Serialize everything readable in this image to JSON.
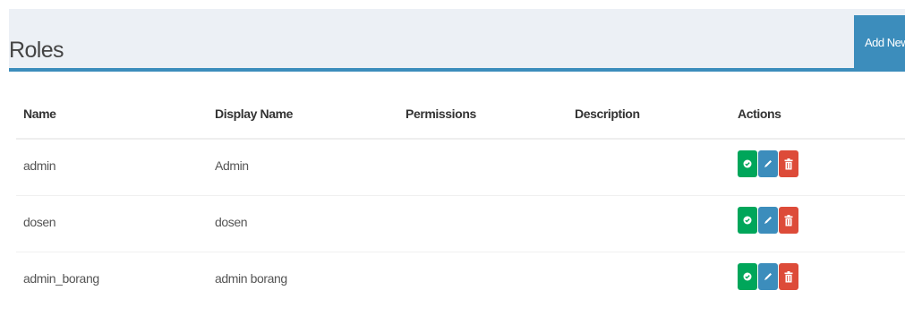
{
  "header": {
    "title": "Roles",
    "add_button_label": "Add New"
  },
  "table": {
    "columns": [
      "Name",
      "Display Name",
      "Permissions",
      "Description",
      "Actions"
    ],
    "rows": [
      {
        "name": "admin",
        "display_name": "Admin",
        "permissions": "",
        "description": ""
      },
      {
        "name": "dosen",
        "display_name": "dosen",
        "permissions": "",
        "description": ""
      },
      {
        "name": "admin_borang",
        "display_name": "admin borang",
        "permissions": "",
        "description": ""
      }
    ]
  },
  "colors": {
    "header_bg": "#ecf0f5",
    "accent": "#3c8dbc",
    "view": "#00a65a",
    "edit": "#3c8dbc",
    "delete": "#dd4b39"
  },
  "icons": {
    "view": "shield-check-icon",
    "edit": "pencil-icon",
    "delete": "trash-icon"
  }
}
